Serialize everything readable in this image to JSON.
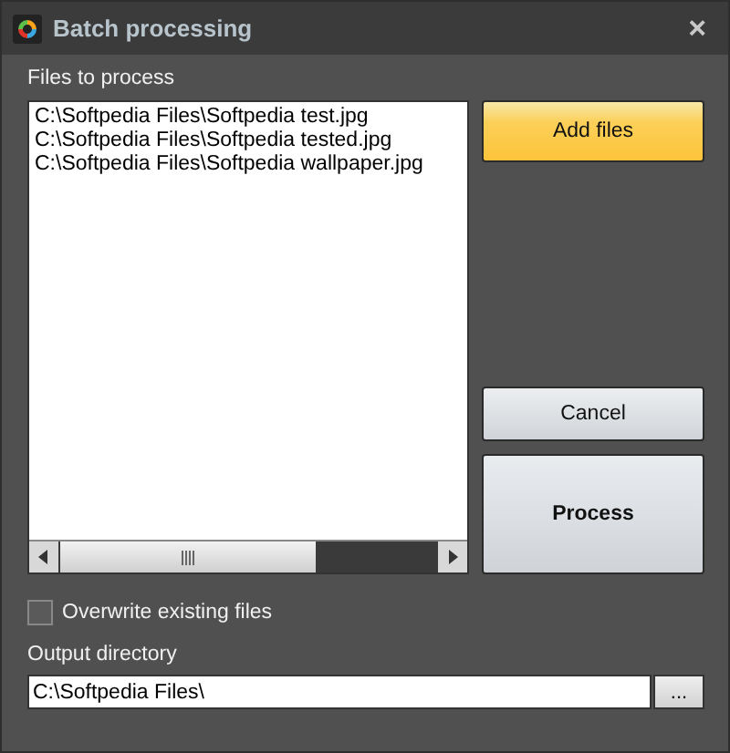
{
  "window": {
    "title": "Batch processing",
    "close": "×"
  },
  "files": {
    "label": "Files to process",
    "items": [
      "C:\\Softpedia Files\\Softpedia test.jpg",
      "C:\\Softpedia Files\\Softpedia tested.jpg",
      "C:\\Softpedia Files\\Softpedia wallpaper.jpg"
    ]
  },
  "buttons": [
    {
      "label": "Add files",
      "kind": "primary"
    },
    {
      "label": "Cancel",
      "kind": "normal"
    },
    {
      "label": "Process",
      "kind": "large"
    }
  ],
  "overwrite": {
    "label": "Overwrite existing files",
    "checked": false
  },
  "output": {
    "label": "Output directory",
    "value": "C:\\Softpedia Files\\",
    "browse": "..."
  }
}
